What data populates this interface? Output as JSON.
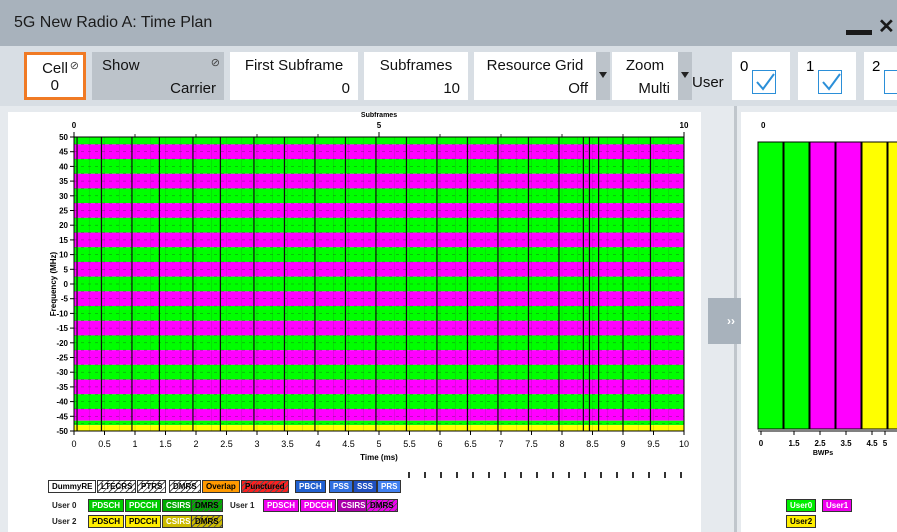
{
  "window": {
    "title": "5G New Radio A: Time Plan"
  },
  "toolbar": {
    "cell": {
      "label": "Cell",
      "value": "0"
    },
    "show": {
      "label": "Show",
      "value": "Carrier"
    },
    "first_subframe": {
      "label": "First Subframe",
      "value": "0"
    },
    "subframes": {
      "label": "Subframes",
      "value": "10"
    },
    "resource_grid": {
      "label": "Resource Grid",
      "value": "Off"
    },
    "zoom": {
      "label": "Zoom",
      "value": "Multi"
    },
    "user_label": "User",
    "users": [
      {
        "n": "0",
        "checked": true
      },
      {
        "n": "1",
        "checked": true
      },
      {
        "n": "2",
        "checked": false
      }
    ]
  },
  "expand_button": "››",
  "chart_data": {
    "type": "heatmap",
    "top_axis": {
      "label": "Subframes",
      "ticks": [
        "0",
        "5",
        "10"
      ]
    },
    "xlabel": "Time (ms)",
    "ylabel": "Frequency (MHz)",
    "xlim": [
      0,
      10
    ],
    "ylim": [
      -50,
      50
    ],
    "x_ticks": [
      "0",
      "0.5",
      "1",
      "1.5",
      "2",
      "2.5",
      "3",
      "3.5",
      "4",
      "4.5",
      "5",
      "5.5",
      "6",
      "6.5",
      "7",
      "7.5",
      "8",
      "8.5",
      "9",
      "9.5",
      "10"
    ],
    "y_ticks": [
      "50",
      "45",
      "40",
      "35",
      "30",
      "25",
      "20",
      "15",
      "10",
      "5",
      "0",
      "-5",
      "-10",
      "-15",
      "-20",
      "-25",
      "-30",
      "-35",
      "-40",
      "-45",
      "-50"
    ],
    "bands": [
      {
        "from": 47.5,
        "to": 50,
        "user": "User0"
      },
      {
        "from": 42.5,
        "to": 47.5,
        "user": "User1"
      },
      {
        "from": 37.5,
        "to": 42.5,
        "user": "User0"
      },
      {
        "from": 32.5,
        "to": 37.5,
        "user": "User1"
      },
      {
        "from": 27.5,
        "to": 32.5,
        "user": "User0"
      },
      {
        "from": 22.5,
        "to": 27.5,
        "user": "User1"
      },
      {
        "from": 17.5,
        "to": 22.5,
        "user": "User0"
      },
      {
        "from": 12.5,
        "to": 17.5,
        "user": "User1"
      },
      {
        "from": 7.5,
        "to": 12.5,
        "user": "User0"
      },
      {
        "from": 2.5,
        "to": 7.5,
        "user": "User1"
      },
      {
        "from": -2.5,
        "to": 2.5,
        "user": "User0"
      },
      {
        "from": -7.5,
        "to": -2.5,
        "user": "User1"
      },
      {
        "from": -12.5,
        "to": -7.5,
        "user": "User0"
      },
      {
        "from": -17.5,
        "to": -12.5,
        "user": "User1"
      },
      {
        "from": -22.5,
        "to": -17.5,
        "user": "User0"
      },
      {
        "from": -27.5,
        "to": -22.5,
        "user": "User1"
      },
      {
        "from": -32.5,
        "to": -27.5,
        "user": "User0"
      },
      {
        "from": -37.5,
        "to": -32.5,
        "user": "User1"
      },
      {
        "from": -42.5,
        "to": -37.5,
        "user": "User0"
      },
      {
        "from": -46.5,
        "to": -42.5,
        "user": "User1"
      },
      {
        "from": -48,
        "to": -46.5,
        "user": "User0"
      },
      {
        "from": -50,
        "to": -48,
        "user": "User2"
      }
    ],
    "slot_lines_ms": [
      0.05,
      0.45,
      0.95,
      1.4,
      1.95,
      2.4,
      2.95,
      3.45,
      3.95,
      4.45,
      4.95,
      5.45,
      5.95,
      6.45,
      6.95,
      7.45,
      7.95,
      8.35,
      8.45,
      8.6,
      9.0,
      9.45
    ],
    "user_colors": {
      "User0": "#00ff00",
      "User1": "#ff00ff",
      "User2": "#ffff00"
    }
  },
  "bwp_chart": {
    "xlabel": "BWPs",
    "top_tick": "0",
    "x_ticks": [
      "0",
      "1.5",
      "2.5",
      "3.5",
      "4.5",
      "5"
    ],
    "bars": [
      {
        "user": "User0",
        "value": 1.0
      },
      {
        "user": "User0",
        "value": 1.0
      },
      {
        "user": "User1",
        "value": 1.0
      },
      {
        "user": "User1",
        "value": 1.0
      },
      {
        "user": "User2",
        "value": 1.0
      },
      {
        "user": "User2",
        "value": 1.0
      }
    ]
  },
  "legend": {
    "row1": [
      {
        "text": "DummyRE",
        "bg": "#ffffff",
        "fg": "#000000"
      },
      {
        "text": "LTECRS",
        "bg": "#ffffff",
        "fg": "#000000",
        "hatch": true
      },
      {
        "text": "PTRS",
        "bg": "#ffffff",
        "fg": "#000000",
        "hatch": true
      },
      {
        "text": "DMRS",
        "bg": "#ffffff",
        "fg": "#000000",
        "hatch": true
      },
      {
        "text": "Overlap",
        "bg": "#ff9900",
        "fg": "#000000"
      },
      {
        "text": "Punctured",
        "bg": "#ff2020",
        "fg": "#000000",
        "hatch": true
      },
      {
        "text": "PBCH",
        "bg": "#2060d0",
        "fg": "#ffffff"
      },
      {
        "text": "PSS",
        "bg": "#3070e0",
        "fg": "#ffffff"
      },
      {
        "text": "SSS",
        "bg": "#2050c0",
        "fg": "#ffffff"
      },
      {
        "text": "PRS",
        "bg": "#4080f0",
        "fg": "#ffffff"
      }
    ],
    "user0_label": "User 0",
    "user0": [
      {
        "text": "PDSCH",
        "bg": "#00cc00",
        "fg": "#ffffff"
      },
      {
        "text": "PDCCH",
        "bg": "#00cc00",
        "fg": "#ffffff"
      },
      {
        "text": "CSIRS",
        "bg": "#00aa00",
        "fg": "#ffffff"
      },
      {
        "text": "DMRS",
        "bg": "#00aa00",
        "fg": "#000000",
        "hatch": true
      }
    ],
    "user1_label": "User 1",
    "user1": [
      {
        "text": "PDSCH",
        "bg": "#ee00ee",
        "fg": "#ffffff"
      },
      {
        "text": "PDCCH",
        "bg": "#ee00ee",
        "fg": "#ffffff"
      },
      {
        "text": "CSIRS",
        "bg": "#aa00aa",
        "fg": "#ffffff"
      },
      {
        "text": "DMRS",
        "bg": "#ee00ee",
        "fg": "#000000",
        "hatch": true
      }
    ],
    "user2_label": "User 2",
    "user2": [
      {
        "text": "PDSCH",
        "bg": "#ffee00",
        "fg": "#000000"
      },
      {
        "text": "PDCCH",
        "bg": "#ffee00",
        "fg": "#000000"
      },
      {
        "text": "CSIRS",
        "bg": "#ccbb00",
        "fg": "#ffffff"
      },
      {
        "text": "DMRS",
        "bg": "#ccbb00",
        "fg": "#000000",
        "hatch": true
      }
    ],
    "bwp_legend": [
      {
        "text": "User0",
        "bg": "#00ee00",
        "fg": "#ffffff"
      },
      {
        "text": "User1",
        "bg": "#ee00ee",
        "fg": "#ffffff"
      },
      {
        "text": "User2",
        "bg": "#ffee00",
        "fg": "#000000"
      }
    ]
  }
}
